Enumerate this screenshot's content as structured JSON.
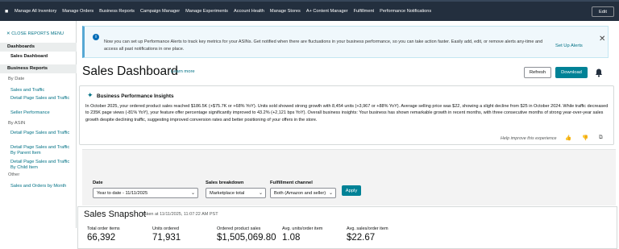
{
  "topnav": {
    "items": [
      "Manage All Inventory",
      "Manage Orders",
      "Business Reports",
      "Campaign Manager",
      "Manage Experiments",
      "Account Health",
      "Manage Stores",
      "A+ Content Manager",
      "Fulfillment",
      "Performance Notifications"
    ],
    "edit_label": "Edit"
  },
  "sidebar": {
    "close_label": "✕  CLOSE REPORTS MENU",
    "dashboards_header": "Dashboards",
    "sales_dashboard": "Sales Dashboard",
    "business_reports_header": "Business Reports",
    "by_date_label": "By Date",
    "by_date_items": [
      "Sales and Traffic",
      "Detail Page Sales and Traffic",
      "Seller Performance"
    ],
    "by_asin_label": "By ASIN",
    "by_asin_items": [
      "Detail Page Sales and Traffic",
      "Detail Page Sales and Traffic By Parent Item",
      "Detail Page Sales and Traffic By Child Item"
    ],
    "other_label": "Other",
    "other_items": [
      "Sales and Orders by Month"
    ]
  },
  "alert": {
    "text": "Now you can set up Performance Alerts to track key metrics for your ASINs. Get notified when there are fluctuations in your business performance, so you can take action faster. Easily add, edit, or remove alerts any-time and access all past notifications in one place.",
    "link": "Set Up Alerts"
  },
  "header": {
    "title": "Sales Dashboard",
    "learn_more": "Learn more",
    "refresh": "Refresh",
    "download": "Download"
  },
  "insights": {
    "title": "Business Performance Insights",
    "body": "In October 2025, your ordered product sales reached $186.5K (+$75.7K or +68% YoY). Units sold showed strong growth with 8,454 units (+3,967 or +88% YoY). Average selling price was $22, showing a slight decline from $25 in October 2024. While traffic decreased to 235K page views (-81% YoY), your feature offer percentage significantly improved to 43.2% (+2,121 bps YoY). Overall business insights: Your business has shown remarkable growth in recent months, with three consecutive months of strong year-over-year sales growth despite declining traffic, suggesting improved conversion rates and better positioning of your offers in the store.",
    "feedback": "Help improve this experience"
  },
  "filters": {
    "date_label": "Date",
    "date_value": "Year to date - 11/11/2025",
    "breakdown_label": "Sales breakdown",
    "breakdown_value": "Marketplace total",
    "channel_label": "Fulfillment channel",
    "channel_value": "Both (Amazon and seller)",
    "apply": "Apply"
  },
  "snapshot": {
    "title": "Sales Snapshot",
    "taken": "taken at 11/11/2025, 11:07:22 AM PST",
    "kpis": [
      {
        "label": "Total order items",
        "value": "66,392"
      },
      {
        "label": "Units ordered",
        "value": "71,931"
      },
      {
        "label": "Ordered product sales",
        "value": "$1,505,069.80"
      },
      {
        "label": "Avg. units/order item",
        "value": "1.08"
      },
      {
        "label": "Avg. sales/order item",
        "value": "$22.67"
      }
    ]
  },
  "colors": {
    "nav_bg": "#232f3e",
    "accent": "#008296",
    "link": "#007185"
  }
}
